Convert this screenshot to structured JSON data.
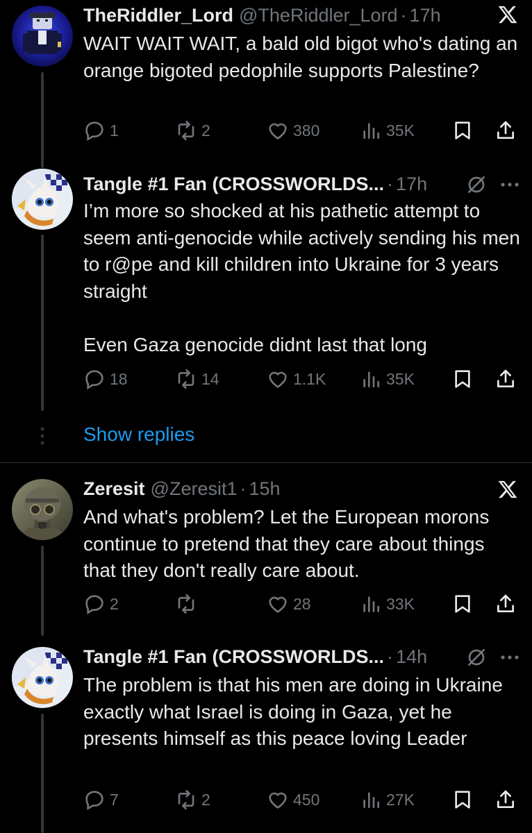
{
  "tweets": [
    {
      "name": "TheRiddler_Lord",
      "handle": "@TheRiddler_Lord",
      "separator": "·",
      "time": "17h",
      "text": "WAIT WAIT WAIT, a bald old bigot who's dating an orange bigoted pedophile supports Palestine?",
      "replies": "1",
      "reposts": "2",
      "likes": "380",
      "views": "35K",
      "corner_icon": "x-logo-icon"
    },
    {
      "name": "Tangle #1 Fan (CROSSWORLDS...",
      "separator": "·",
      "time": "17h",
      "text": "I’m more so shocked at his pathetic attempt to seem anti-genocide while actively sending his men to r@pe and kill children into Ukraine for 3 years straight\n\nEven Gaza genocide didnt last that long",
      "replies": "18",
      "reposts": "14",
      "likes": "1.1K",
      "views": "35K",
      "corner_icon": "grok-icon"
    },
    {
      "name": "Zeresit",
      "handle": "@Zeresit1",
      "separator": "·",
      "time": "15h",
      "text": "And what's problem? Let the European morons continue to pretend that they care about things that they don't really care about.",
      "replies": "2",
      "reposts": "",
      "likes": "28",
      "views": "33K",
      "corner_icon": "x-logo-icon"
    },
    {
      "name": "Tangle #1 Fan (CROSSWORLDS...",
      "separator": "·",
      "time": "14h",
      "text": "The problem is that his men are doing in Ukraine exactly what Israel is doing in Gaza, yet he presents himself as this peace loving Leader",
      "replies": "7",
      "reposts": "2",
      "likes": "450",
      "views": "27K",
      "corner_icon": "grok-icon"
    }
  ],
  "show_replies_label": "Show replies",
  "colors": {
    "background": "#000000",
    "text": "#e7e9ea",
    "secondary": "#71767b",
    "link": "#1d9bf0",
    "divider": "#2f3336"
  }
}
